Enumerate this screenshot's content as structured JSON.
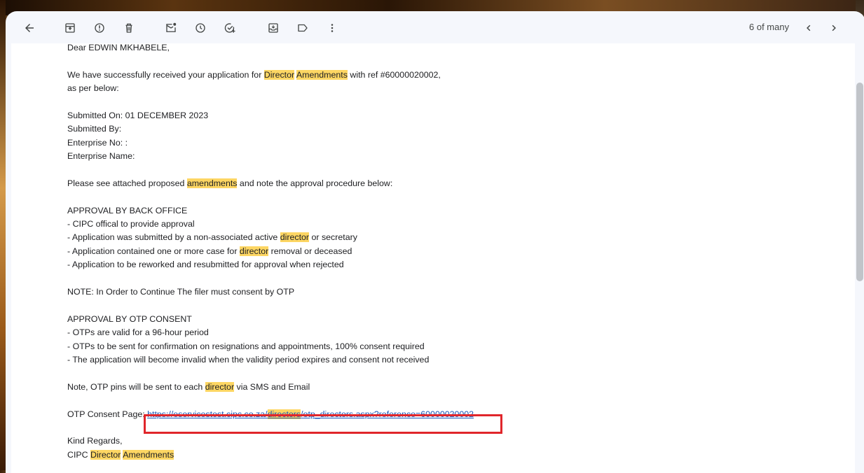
{
  "toolbar": {
    "buttons": [
      {
        "name": "back-button",
        "icon": "arrow-back-icon"
      },
      {
        "name": "archive-button",
        "icon": "archive-icon"
      },
      {
        "name": "report-spam-button",
        "icon": "report-icon"
      },
      {
        "name": "delete-button",
        "icon": "delete-icon"
      },
      {
        "name": "mark-unread-button",
        "icon": "mark-unread-icon"
      },
      {
        "name": "snooze-button",
        "icon": "clock-icon"
      },
      {
        "name": "add-task-button",
        "icon": "add-task-icon"
      },
      {
        "name": "move-to-button",
        "icon": "move-to-icon"
      },
      {
        "name": "label-button",
        "icon": "label-icon"
      },
      {
        "name": "more-button",
        "icon": "more-vert-icon"
      }
    ],
    "page_count": "6 of many",
    "newer_icon": "chevron-left-icon",
    "older_icon": "chevron-right-icon"
  },
  "email": {
    "greeting": "Dear EDWIN MKHABELE,",
    "p1_a": "We have successfully received your application for ",
    "p1_hl1": "Director",
    "p1_hl2": "Amendments",
    "p1_b": " with ref #60000020002,",
    "p1_c": "as per below:",
    "submitted_on": "Submitted On: 01 DECEMBER 2023",
    "submitted_by": "Submitted By:",
    "enterprise_no": "Enterprise No: :",
    "enterprise_name": "Enterprise Name:",
    "p2_a": "Please see attached proposed ",
    "p2_hl": "amendments",
    "p2_b": " and note the approval procedure below:",
    "approval_back_title": "APPROVAL BY BACK OFFICE",
    "ab1": "- CIPC offical to provide approval",
    "ab2_a": "- Application was submitted by a non-associated active ",
    "ab2_hl": "director",
    "ab2_b": " or secretary",
    "ab3_a": "- Application contained one or more case for ",
    "ab3_hl": "director",
    "ab3_b": " removal or deceased",
    "ab4": "- Application to be reworked and resubmitted for approval when rejected",
    "note1": "NOTE: In Order to Continue The filer must consent by OTP",
    "approval_otp_title": "APPROVAL BY OTP CONSENT",
    "ao1": "- OTPs are valid for a 96-hour period",
    "ao2": "- OTPs to be sent for confirmation on resignations and appointments, 100% consent required",
    "ao3": "- The application will become invalid when the validity period expires and consent not received",
    "note2_a": "Note, OTP pins will be sent to each ",
    "note2_hl": "director",
    "note2_b": " via SMS and Email",
    "otp_label": "OTP Consent Page: ",
    "otp_link_a": "https://eservicestest.cipc.co.za/",
    "otp_link_hl": "directors",
    "otp_link_b": "/otp_directors.aspx?reference=60000020002",
    "regards": "Kind Regards,",
    "sig_a": "CIPC ",
    "sig_hl1": "Director",
    "sig_hl2": "Amendments"
  },
  "colors": {
    "highlight": "#fdd663",
    "annotation_box": "#e0262b",
    "link": "#1a56b8"
  }
}
